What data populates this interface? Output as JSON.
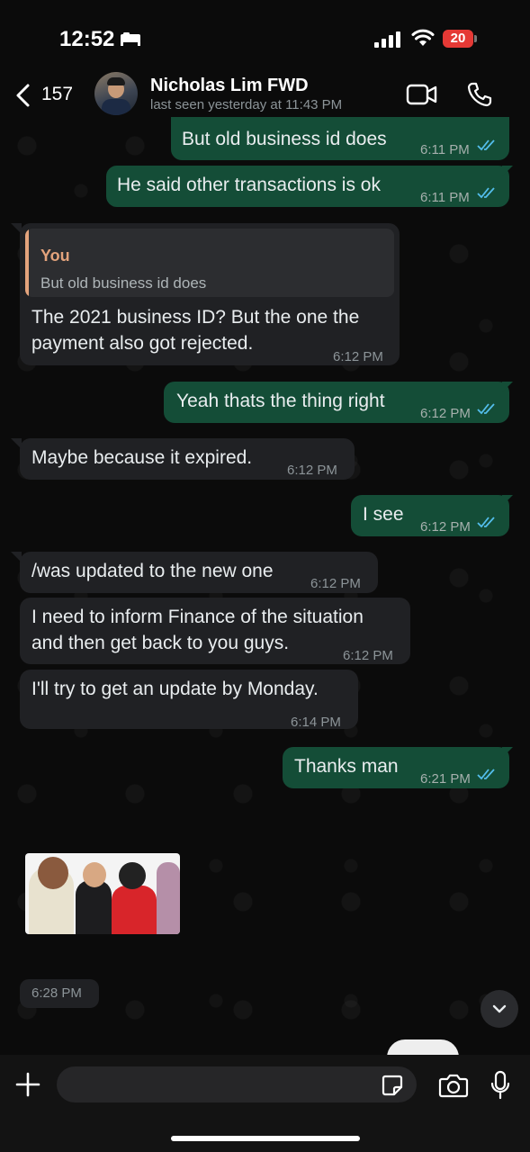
{
  "status_bar": {
    "time": "12:52",
    "battery": "20"
  },
  "header": {
    "back_count": "157",
    "contact_name": "Nicholas Lim FWD",
    "last_seen": "last seen yesterday at 11:43 PM"
  },
  "messages": [
    {
      "direction": "out",
      "text": "But old business id does",
      "time": "6:11 PM"
    },
    {
      "direction": "out",
      "text": "He said other transactions is ok",
      "time": "6:11 PM"
    },
    {
      "direction": "in",
      "quote_author": "You",
      "quote_text": "But old business id does",
      "text_line1": "The 2021 business ID? But the one the",
      "text_line2": "payment also got rejected.",
      "time": "6:12 PM"
    },
    {
      "direction": "out",
      "text": "Yeah thats the thing right",
      "time": "6:12 PM"
    },
    {
      "direction": "in",
      "text": "Maybe because it expired.",
      "time": "6:12 PM"
    },
    {
      "direction": "out",
      "text": "I see",
      "time": "6:12 PM"
    },
    {
      "direction": "in",
      "text": "/was updated to the new one",
      "time": "6:12 PM"
    },
    {
      "direction": "in",
      "text_line1": "I need to inform Finance of the situation",
      "text_line2": "and then get back to you guys.",
      "time": "6:12 PM"
    },
    {
      "direction": "in",
      "text": "I'll try to get an update by Monday.",
      "time": "6:14 PM"
    },
    {
      "direction": "out",
      "text": "Thanks man",
      "time": "6:21 PM"
    }
  ],
  "sticker": {
    "time": "6:28 PM"
  },
  "composer": {
    "placeholder": ""
  },
  "colors": {
    "outgoing_bubble": "#144d37",
    "incoming_bubble": "#202124",
    "read_ticks": "#53bdeb",
    "quote_accent": "#e3a37c"
  },
  "icons": [
    "bed-icon",
    "signal-icon",
    "wifi-icon",
    "back-icon",
    "video-call-icon",
    "phone-call-icon",
    "read-ticks-icon",
    "chevron-down-icon",
    "plus-icon",
    "sticker-icon",
    "camera-icon",
    "mic-icon"
  ]
}
